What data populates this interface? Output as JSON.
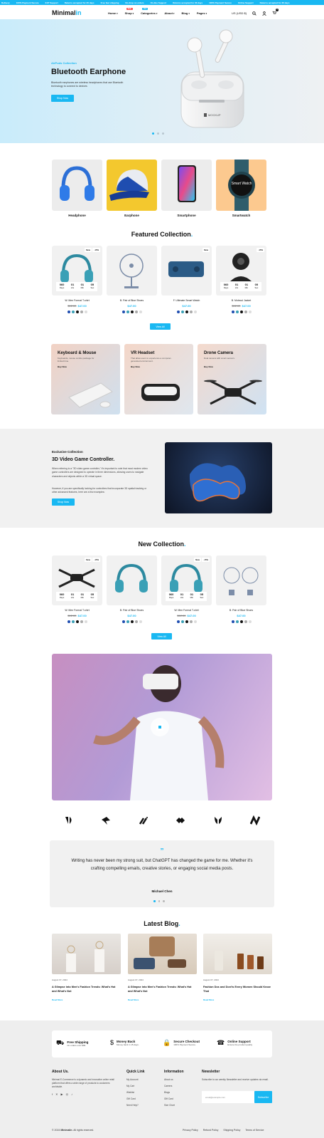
{
  "topbar": {
    "items": [
      "Delivery",
      "100% Payment Secure",
      "24/7 Support",
      "Returns accepted for 30 days",
      "Free fast shipping",
      "No drop on orders",
      "On-line Support",
      "Returns accepted for 30 days",
      "100% Payment Secure",
      "Online Support",
      "Returns accepted for 30 days"
    ]
  },
  "header": {
    "logo_main": "Minimal",
    "logo_accent": "in",
    "nav": [
      {
        "label": "Home",
        "badge": ""
      },
      {
        "label": "Shop",
        "badge": "Sale"
      },
      {
        "label": "Categories",
        "badge": "Hot"
      },
      {
        "label": "About",
        "badge": ""
      },
      {
        "label": "Blog",
        "badge": ""
      },
      {
        "label": "Pages",
        "badge": ""
      }
    ],
    "currency": "US (USD $)",
    "cart_count": "0"
  },
  "hero": {
    "eyebrow": "AirPods Collection",
    "title": "Bluetooth Earphone",
    "desc": "Bluetooth earphones are wireless headphones that use Bluetooth technology to connect to devices",
    "button": "Shop Now",
    "case_label": "MOCKUP"
  },
  "categories": [
    "Headphone",
    "Earphone",
    "Smartphone",
    "Smartwatch"
  ],
  "smartwatch_text": "Smart Watch",
  "featured": {
    "title_main": "Featured Collection",
    "title_dot": ".",
    "products": [
      {
        "name": "W. Men Formal T-shirt",
        "old": "$12.00",
        "price": "$47.00",
        "tags": [
          "New",
          "-15%"
        ],
        "countdown": true
      },
      {
        "name": "B. Pair of Blue Shoes",
        "old": "",
        "price": "$47.00",
        "tags": [],
        "countdown": false
      },
      {
        "name": "F. Ultimate Smart Watch",
        "old": "",
        "price": "$47.00",
        "tags": [
          "New"
        ],
        "countdown": false
      },
      {
        "name": "B. Molecul Jacket",
        "old": "$12.00",
        "price": "$47.00",
        "tags": [
          "-15%"
        ],
        "countdown": true
      }
    ],
    "countdown": [
      {
        "num": "060",
        "lbl": "Days"
      },
      {
        "num": "01",
        "lbl": "Hrs"
      },
      {
        "num": "01",
        "lbl": "Min"
      },
      {
        "num": "05",
        "lbl": "Sec"
      }
    ],
    "view_all": "View All"
  },
  "promos": [
    {
      "title": "Keyboard & Mouse",
      "desc": "Keyboards, mouse combo package for limited time.",
      "link": "Buy Now"
    },
    {
      "title": "VR Headset",
      "desc": "That allow users to experience a computer-generated environment.",
      "link": "Buy Now"
    },
    {
      "title": "Drone Camera",
      "desc": "Dual camera with smart sensors.",
      "link": "Buy Now"
    }
  ],
  "exclusive": {
    "eyebrow": "Exclusive Collection",
    "title": "3D Video Game Controller.",
    "p1": "When referring to a \"3D video game controller,\" it's important to note that most modern video game controllers are designed to operate in three dimensions, allowing users to navigate characters and objects within a 3D virtual space.",
    "p2": "However, if you are specifically looking for controllers that incorporate 3D spatial tracking or other advanced features, here are a few examples:",
    "button": "Shop Now"
  },
  "new_collection": {
    "title_main": "New Collection",
    "title_dot": ".",
    "products": [
      {
        "name": "W. Men Formal T-shirt",
        "old": "$12.00",
        "price": "$47.00",
        "tags": [
          "New",
          "-15%"
        ],
        "countdown": true
      },
      {
        "name": "B. Pair of Blue Shoes",
        "old": "",
        "price": "$47.00",
        "tags": [],
        "countdown": false
      },
      {
        "name": "W. Men Formal T-shirt",
        "old": "$12.00",
        "price": "$47.00",
        "tags": [
          "New",
          "-15%"
        ],
        "countdown": true
      },
      {
        "name": "B. Pair of Blue Shoes",
        "old": "",
        "price": "$47.00",
        "tags": [],
        "countdown": false
      }
    ],
    "view_all": "View All"
  },
  "testimonial": {
    "quote_mark": "”",
    "text": "Writing has never been my strong suit, but ChatGPT has changed the game for me. Whether it's crafting compelling emails, creative stories, or engaging social media posts.",
    "author": "Michael Chen"
  },
  "blog": {
    "title_main": "Latest Blog",
    "title_dot": ".",
    "posts": [
      {
        "date": "August 07, 2024",
        "title": "A Glimpse into Men's Fashion Trends: What's Hot and What's Not",
        "link": "Read More"
      },
      {
        "date": "August 07, 2024",
        "title": "A Glimpse into Men's Fashion Trends: What's Hot and What's Not",
        "link": "Read More"
      },
      {
        "date": "August 07, 2024",
        "title": "Fashion Dos and Don'ts Every Women Should Know That",
        "link": "Read More"
      }
    ]
  },
  "features": [
    {
      "title": "Free Shipping",
      "sub": "On orders over $99."
    },
    {
      "title": "Money Back",
      "sub": "Money back in 15 days."
    },
    {
      "title": "Secure Checkout",
      "sub": "100% Payment Secure."
    },
    {
      "title": "Online Support",
      "sub": "Ensure the product quality"
    }
  ],
  "footer": {
    "about_title": "About Us.",
    "about_text": "Minimal E-Commerce is a dynamic and innovative online retail platform that offers a wide range of products to customers worldwide.",
    "quick_title": "Quick Link",
    "quick": [
      "My Account",
      "My Cart",
      "Wishlist",
      "Gift Card",
      "Need Help?"
    ],
    "info_title": "Information",
    "info": [
      "About us",
      "Careers",
      "Blogs",
      "Gift Card",
      "Size Chart"
    ],
    "news_title": "Newsletter",
    "news_text": "Subscribe to our weekly Newsletter and receive updates via email.",
    "email_placeholder": "email@example.com",
    "subscribe": "Subscribe",
    "copyright_pre": "© 2024",
    "copyright_brand": "Minimalin",
    "copyright_post": ". All rights reserved.",
    "links": [
      "Privacy Policy",
      "Refund Policy",
      "Shipping Policy",
      "Terms of Service"
    ]
  },
  "colors": {
    "accent": "#19b8f2",
    "sale_badge": "#ff4d4d",
    "hot_badge": "#19b8f2"
  }
}
